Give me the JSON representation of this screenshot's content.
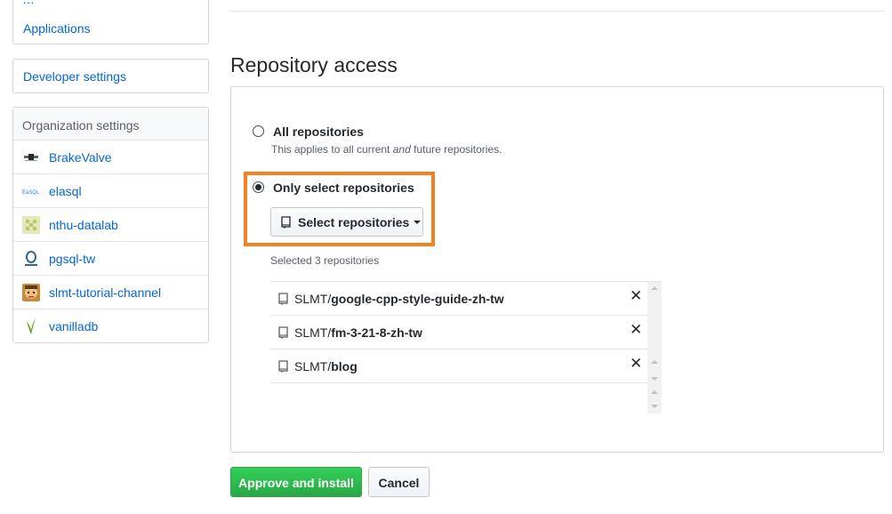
{
  "sidebar": {
    "top_item_label": "Applications",
    "developer_settings_label": "Developer settings",
    "org_header": "Organization settings",
    "orgs": [
      {
        "name": "BrakeValve",
        "icon": "brakevalve-logo-icon"
      },
      {
        "name": "elasql",
        "icon": "elasql-logo-icon"
      },
      {
        "name": "nthu-datalab",
        "icon": "nthu-datalab-logo-icon"
      },
      {
        "name": "pgsql-tw",
        "icon": "pgsql-tw-logo-icon"
      },
      {
        "name": "slmt-tutorial-channel",
        "icon": "slmt-tutorial-channel-avatar-icon"
      },
      {
        "name": "vanilladb",
        "icon": "vanilladb-logo-icon"
      }
    ]
  },
  "main": {
    "heading": "Repository access",
    "option_all": {
      "label": "All repositories",
      "note_prefix": "This applies to all current ",
      "note_em": "and",
      "note_suffix": " future repositories.",
      "checked": false
    },
    "option_select": {
      "label": "Only select repositories",
      "checked": true
    },
    "select_button_label": "Select repositories",
    "selected_count_text": "Selected 3 repositories",
    "repos": [
      {
        "owner": "SLMT/",
        "name": "google-cpp-style-guide-zh-tw"
      },
      {
        "owner": "SLMT/",
        "name": "fm-3-21-8-zh-tw"
      },
      {
        "owner": "SLMT/",
        "name": "blog"
      }
    ],
    "remove_glyph": "✕",
    "approve_label": "Approve and install",
    "cancel_label": "Cancel"
  },
  "colors": {
    "link": "#0366d6",
    "highlight": "#f48024",
    "primary": "#28a745"
  }
}
